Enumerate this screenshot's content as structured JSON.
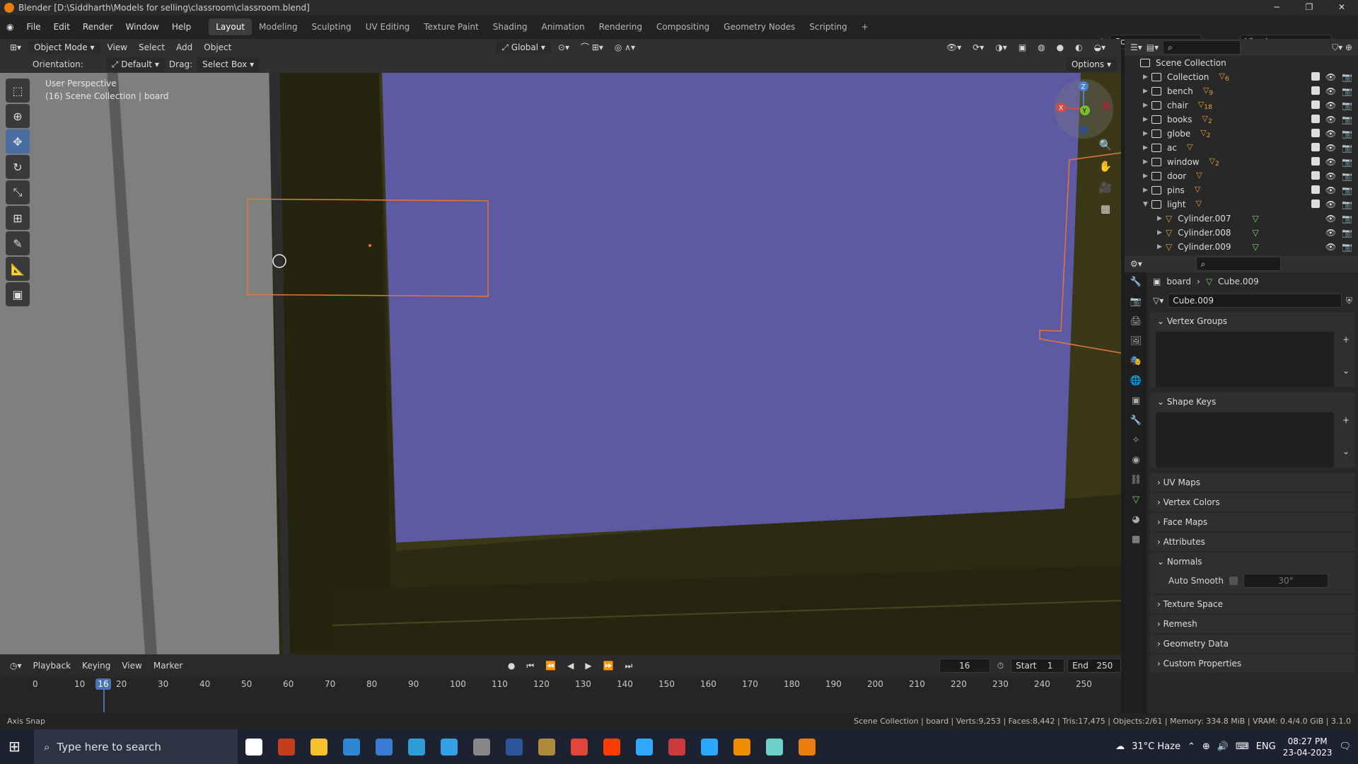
{
  "title": "Blender [D:\\Siddharth\\Models for selling\\classroom\\classroom.blend]",
  "menus": [
    "File",
    "Edit",
    "Render",
    "Window",
    "Help"
  ],
  "workspaces": [
    "Layout",
    "Modeling",
    "Sculpting",
    "UV Editing",
    "Texture Paint",
    "Shading",
    "Animation",
    "Rendering",
    "Compositing",
    "Geometry Nodes",
    "Scripting"
  ],
  "active_workspace": "Layout",
  "scene": {
    "name": "Scene",
    "view_layer": "ViewLayer"
  },
  "viewport_header": {
    "mode": "Object Mode",
    "items": [
      "View",
      "Select",
      "Add",
      "Object"
    ],
    "transform": "Global",
    "options": "Options"
  },
  "tool_settings": {
    "orientation_label": "Orientation:",
    "orientation": "Default",
    "drag_label": "Drag:",
    "drag": "Select Box"
  },
  "viewport": {
    "view_name": "User Perspective",
    "context": "(16) Scene Collection | board"
  },
  "gizmo": {
    "x": "X",
    "y": "Y",
    "z": "Z"
  },
  "outliner": {
    "root": "Scene Collection",
    "items": [
      {
        "name": "Collection",
        "badge": "6"
      },
      {
        "name": "bench",
        "badge": "9"
      },
      {
        "name": "chair",
        "badge": "18"
      },
      {
        "name": "books",
        "badge": "2"
      },
      {
        "name": "globe",
        "badge": "2"
      },
      {
        "name": "ac",
        "badge": ""
      },
      {
        "name": "window",
        "badge": "2"
      },
      {
        "name": "door",
        "badge": ""
      },
      {
        "name": "pins",
        "badge": ""
      },
      {
        "name": "light",
        "badge": ""
      }
    ],
    "children": [
      "Cylinder.007",
      "Cylinder.008",
      "Cylinder.009"
    ]
  },
  "properties": {
    "breadcrumb_object": "board",
    "breadcrumb_data": "Cube.009",
    "data_name": "Cube.009",
    "panels": [
      "Vertex Groups",
      "Shape Keys",
      "UV Maps",
      "Vertex Colors",
      "Face Maps",
      "Attributes",
      "Normals",
      "Texture Space",
      "Remesh",
      "Geometry Data",
      "Custom Properties"
    ],
    "auto_smooth_label": "Auto Smooth",
    "auto_smooth_angle": "30°"
  },
  "timeline": {
    "menus": [
      "Playback",
      "Keying",
      "View",
      "Marker"
    ],
    "current_frame": "16",
    "start_label": "Start",
    "start": "1",
    "end_label": "End",
    "end": "250",
    "ticks": [
      "0",
      "10",
      "20",
      "30",
      "40",
      "50",
      "60",
      "70",
      "80",
      "90",
      "100",
      "110",
      "120",
      "130",
      "140",
      "150",
      "160",
      "170",
      "180",
      "190",
      "200",
      "210",
      "220",
      "230",
      "240",
      "250"
    ]
  },
  "status": {
    "left": "Axis Snap",
    "right": "Scene Collection | board | Verts:9,253 | Faces:8,442 | Tris:17,475 | Objects:2/61 | Memory: 334.8 MiB | VRAM: 0.4/4.0 GiB | 3.1.0"
  },
  "taskbar": {
    "search_placeholder": "Type here to search",
    "weather": "31°C  Haze",
    "lang": "ENG",
    "time": "08:27 PM",
    "date": "23-04-2023",
    "apps": [
      "task-view",
      "powerpoint",
      "explorer",
      "store-mail",
      "calendar",
      "edge",
      "azure",
      "photos",
      "word",
      "books",
      "chrome",
      "illustrator",
      "photoshop",
      "stylus",
      "v-app",
      "vlc",
      "vectorworks",
      "blender"
    ]
  },
  "colors": {
    "accent": "#4a73b3",
    "window_pane": "#5b5aa3",
    "frame": "#2f2e14",
    "selection": "#e8743b"
  }
}
